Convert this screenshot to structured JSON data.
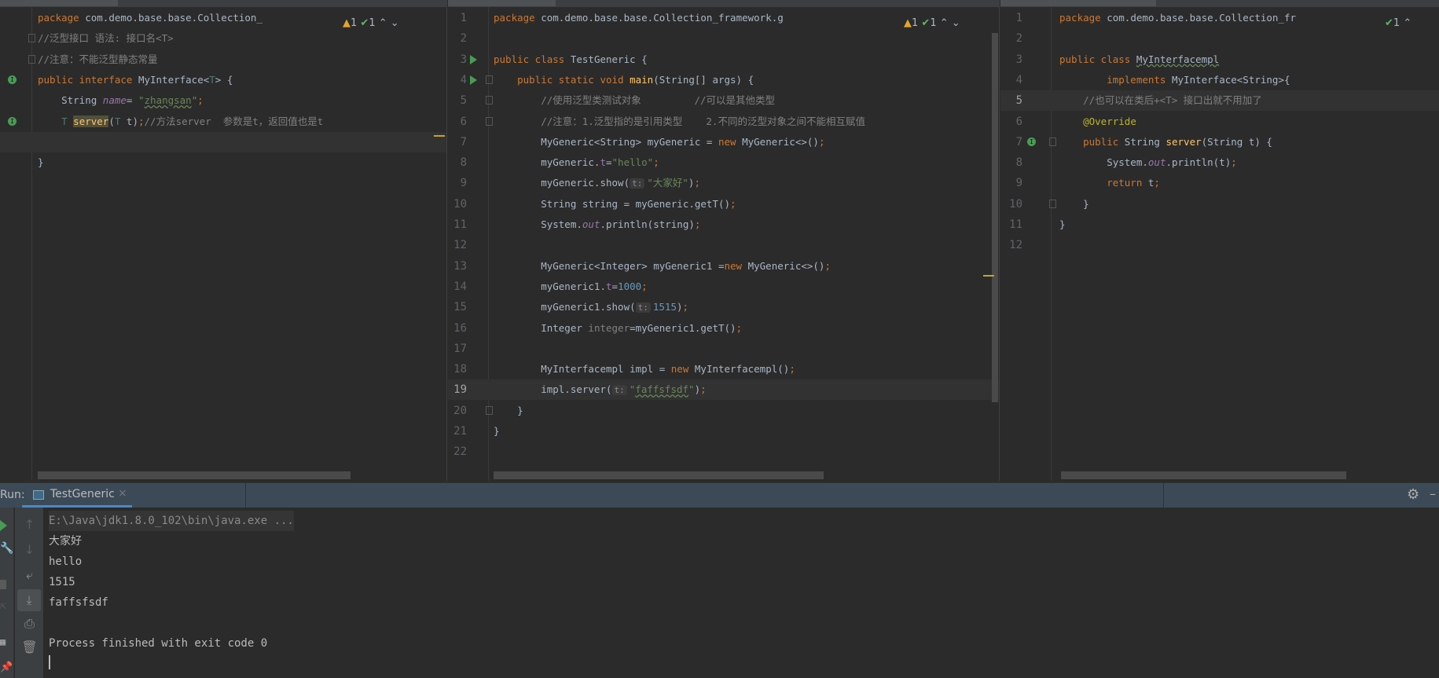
{
  "left_editor": {
    "inspections": {
      "warnings": "1",
      "ok": "1"
    },
    "lines": [
      [
        [
          "package ",
          "k"
        ],
        [
          "com.demo.base.base.Collection_",
          ""
        ]
      ],
      [
        [
          "//泛型接口 语法: 接口名<T>",
          "c"
        ]
      ],
      [
        [
          "//注意：不能泛型静态常量",
          "c"
        ]
      ],
      [
        [
          "public interface ",
          "k"
        ],
        [
          "MyInterface<",
          ""
        ],
        [
          "T",
          "t"
        ],
        [
          "> {",
          ""
        ]
      ],
      [
        [
          "    String ",
          ""
        ],
        [
          "name",
          "f"
        ],
        [
          "= ",
          ""
        ],
        [
          "\"",
          "s"
        ],
        [
          "zhangsan",
          "s w"
        ],
        [
          "\"",
          "s"
        ],
        [
          ";",
          "k"
        ]
      ],
      [
        [
          "    ",
          ""
        ],
        [
          "T ",
          "t"
        ],
        [
          "server",
          "hl"
        ],
        [
          "(",
          ""
        ],
        [
          "T ",
          "t"
        ],
        [
          "t)",
          ""
        ],
        [
          ";",
          "k"
        ],
        [
          "//方法server  参数是t，返回值也是t",
          "c"
        ]
      ],
      [
        [
          "",
          ""
        ]
      ],
      [
        [
          "}",
          ""
        ]
      ]
    ]
  },
  "middle_editor": {
    "inspections": {
      "warnings": "1",
      "ok": "1"
    },
    "lines": [
      [
        [
          "package ",
          "k"
        ],
        [
          "com.demo.base.base.Collection_framework.g",
          ""
        ]
      ],
      [],
      [
        [
          "public class ",
          "k"
        ],
        [
          "TestGeneric {",
          ""
        ]
      ],
      [
        [
          "    public static void ",
          "k"
        ],
        [
          "main",
          "m"
        ],
        [
          "(String[] args) {",
          ""
        ]
      ],
      [
        [
          "        //使用泛型类测试对象         //可以是其他类型",
          "c"
        ]
      ],
      [
        [
          "        //注意：1.泛型指的是引用类型    2.不同的泛型对象之间不能相互赋值",
          "c"
        ]
      ],
      [
        [
          "        MyGeneric<String> myGeneric = ",
          ""
        ],
        [
          "new ",
          "k"
        ],
        [
          "MyGeneric<>()",
          ""
        ],
        [
          ";",
          "k"
        ]
      ],
      [
        [
          "        myGeneric.",
          ""
        ],
        [
          "t",
          "fp"
        ],
        [
          "=",
          ""
        ],
        [
          "\"hello\"",
          "s"
        ],
        [
          ";",
          "k"
        ]
      ],
      [
        [
          "        myGeneric.show(",
          ""
        ],
        [
          "t:",
          "h"
        ],
        [
          "\"大家好\"",
          "s"
        ],
        [
          ")",
          ""
        ],
        [
          ";",
          "k"
        ]
      ],
      [
        [
          "        String string = myGeneric.getT()",
          ""
        ],
        [
          ";",
          "k"
        ]
      ],
      [
        [
          "        System.",
          ""
        ],
        [
          "out",
          "f"
        ],
        [
          ".println(string)",
          ""
        ],
        [
          ";",
          "k"
        ]
      ],
      [],
      [
        [
          "        MyGeneric<Integer> myGeneric1 =",
          ""
        ],
        [
          "new ",
          "k"
        ],
        [
          "MyGeneric<>()",
          ""
        ],
        [
          ";",
          "k"
        ]
      ],
      [
        [
          "        myGeneric1.",
          ""
        ],
        [
          "t",
          "fp"
        ],
        [
          "=",
          ""
        ],
        [
          "1000",
          "n"
        ],
        [
          ";",
          "k"
        ]
      ],
      [
        [
          "        myGeneric1.show(",
          ""
        ],
        [
          "t:",
          "h"
        ],
        [
          "1515",
          "n"
        ],
        [
          ")",
          ""
        ],
        [
          ";",
          "k"
        ]
      ],
      [
        [
          "        Integer ",
          ""
        ],
        [
          "integer",
          "g"
        ],
        [
          "=myGeneric1.getT()",
          ""
        ],
        [
          ";",
          "k"
        ]
      ],
      [],
      [
        [
          "        MyInterfacempl impl = ",
          ""
        ],
        [
          "new ",
          "k"
        ],
        [
          "MyInterfacempl()",
          ""
        ],
        [
          ";",
          "k"
        ]
      ],
      [
        [
          "        impl.server(",
          ""
        ],
        [
          "t:",
          "h"
        ],
        [
          "\"",
          "s"
        ],
        [
          "faffsfsdf",
          "s w"
        ],
        [
          "\"",
          "s"
        ],
        [
          ")",
          ""
        ],
        [
          ";",
          "k"
        ]
      ],
      [
        [
          "    }",
          ""
        ]
      ],
      [
        [
          "}",
          ""
        ]
      ],
      []
    ]
  },
  "right_editor": {
    "inspections": {
      "ok": "1"
    },
    "lines": [
      [
        [
          "package ",
          "k"
        ],
        [
          "com.demo.base.base.Collection_fr",
          ""
        ]
      ],
      [],
      [
        [
          "public class ",
          "k"
        ],
        [
          "MyInterfacempl",
          "w"
        ]
      ],
      [
        [
          "        implements ",
          "k"
        ],
        [
          "MyInterface<String>{",
          ""
        ]
      ],
      [
        [
          "    //也可以在类后+<T> 接口出就不用加了",
          "c"
        ]
      ],
      [
        [
          "    ",
          ""
        ],
        [
          "@Override",
          "a"
        ]
      ],
      [
        [
          "    public ",
          "k"
        ],
        [
          "String ",
          ""
        ],
        [
          "server",
          "m"
        ],
        [
          "(String t) {",
          ""
        ]
      ],
      [
        [
          "        System.",
          ""
        ],
        [
          "out",
          "f"
        ],
        [
          ".println(t)",
          ""
        ],
        [
          ";",
          "k"
        ]
      ],
      [
        [
          "        return ",
          "k"
        ],
        [
          "t",
          ""
        ],
        [
          ";",
          "k"
        ]
      ],
      [
        [
          "    }",
          ""
        ]
      ],
      [
        [
          "}",
          ""
        ]
      ],
      []
    ]
  },
  "run_panel": {
    "label": "Run:",
    "tab": "TestGeneric",
    "output": [
      "E:\\Java\\jdk1.8.0_102\\bin\\java.exe ...",
      "大家好",
      "hello",
      "1515",
      "faffsfsdf",
      "",
      "Process finished with exit code 0"
    ]
  }
}
